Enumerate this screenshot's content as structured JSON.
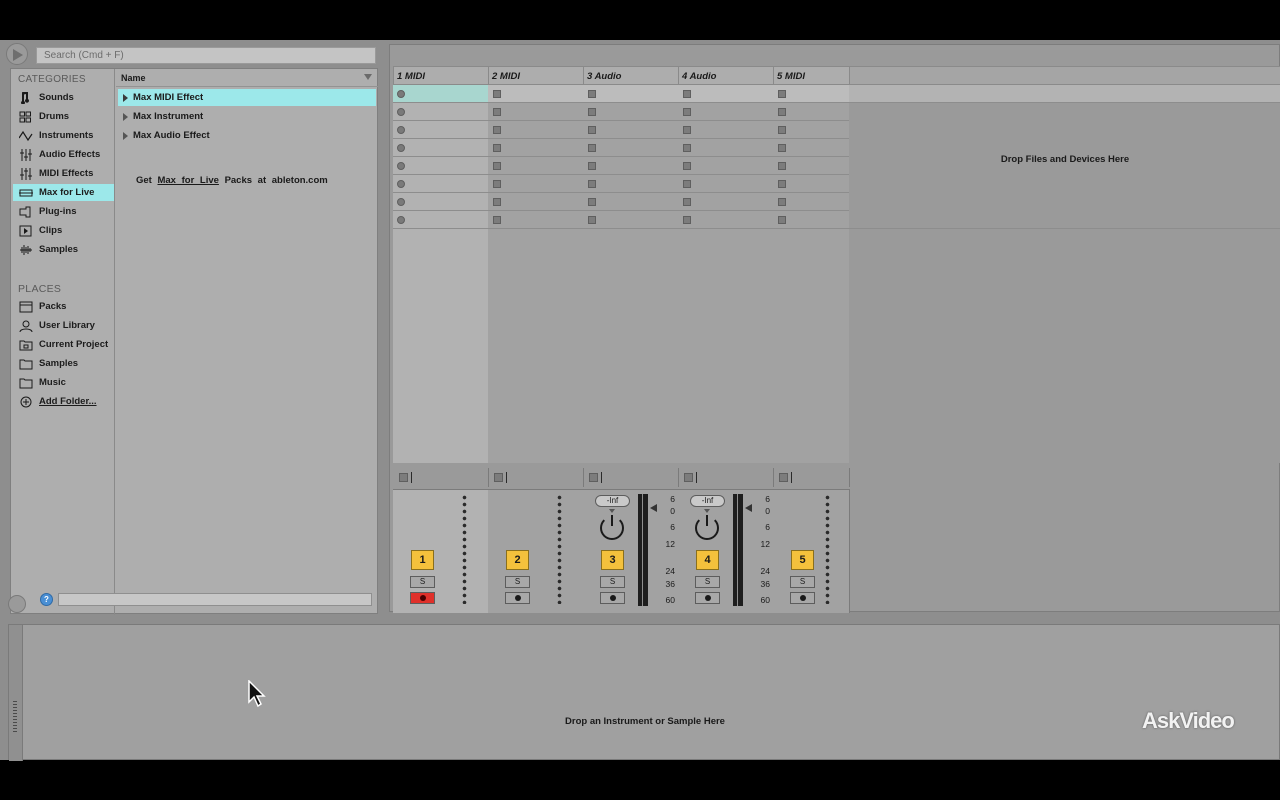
{
  "search": {
    "placeholder": "Search (Cmd + F)"
  },
  "categories": {
    "title": "CATEGORIES",
    "items": [
      {
        "label": "Sounds",
        "icon": "music-note-icon"
      },
      {
        "label": "Drums",
        "icon": "drum-grid-icon"
      },
      {
        "label": "Instruments",
        "icon": "waveform-icon"
      },
      {
        "label": "Audio Effects",
        "icon": "audio-effects-icon"
      },
      {
        "label": "MIDI Effects",
        "icon": "midi-effects-icon"
      },
      {
        "label": "Max for Live",
        "icon": "max-for-live-icon",
        "selected": true
      },
      {
        "label": "Plug-ins",
        "icon": "plugin-icon"
      },
      {
        "label": "Clips",
        "icon": "clip-icon"
      },
      {
        "label": "Samples",
        "icon": "samples-icon"
      }
    ]
  },
  "places": {
    "title": "PLACES",
    "items": [
      {
        "label": "Packs",
        "icon": "packs-icon"
      },
      {
        "label": "User Library",
        "icon": "user-icon"
      },
      {
        "label": "Current Project",
        "icon": "project-folder-icon"
      },
      {
        "label": "Samples",
        "icon": "folder-icon"
      },
      {
        "label": "Music",
        "icon": "folder-icon"
      },
      {
        "label": "Add Folder...",
        "icon": "add-folder-icon"
      }
    ]
  },
  "files": {
    "header": "Name",
    "rows": [
      {
        "label": "Max MIDI Effect",
        "selected": true
      },
      {
        "label": "Max Instrument"
      },
      {
        "label": "Max Audio Effect"
      }
    ],
    "promo": {
      "get": "Get",
      "link": "Max for Live",
      "packs_at": "Packs at",
      "site": "ableton.com"
    }
  },
  "tracks": [
    {
      "name": "1 MIDI",
      "number": "1",
      "type": "midi",
      "arm_active": true
    },
    {
      "name": "2 MIDI",
      "number": "2",
      "type": "midi"
    },
    {
      "name": "3 Audio",
      "number": "3",
      "type": "audio",
      "volume": "-Inf"
    },
    {
      "name": "4 Audio",
      "number": "4",
      "type": "audio",
      "volume": "-Inf"
    },
    {
      "name": "5 MIDI",
      "number": "5",
      "type": "midi"
    }
  ],
  "solo_label": "S",
  "meter_scale": [
    "6",
    "0",
    "6",
    "12",
    "24",
    "36",
    "60"
  ],
  "session": {
    "drop_text": "Drop Files and Devices Here"
  },
  "detail": {
    "drop_text": "Drop an Instrument or Sample Here"
  },
  "watermark": "AskVideo",
  "colors": {
    "selection": "#9ce8ea",
    "track_number": "#f4c13c",
    "arm_active": "#e0302a",
    "info": "#4a8fd4"
  }
}
